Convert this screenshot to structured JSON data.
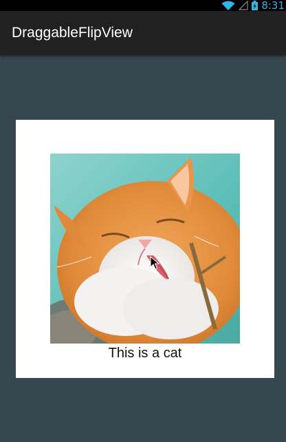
{
  "status_bar": {
    "time": "8:31",
    "icons": [
      "wifi-icon",
      "signal-icon",
      "battery-charging-icon"
    ],
    "accent_color": "#33b5e5"
  },
  "action_bar": {
    "title": "DraggableFlipView",
    "background": "#212121"
  },
  "page": {
    "background": "#37474f"
  },
  "flip_card": {
    "image": "cat-photo",
    "caption": "This is a cat"
  }
}
